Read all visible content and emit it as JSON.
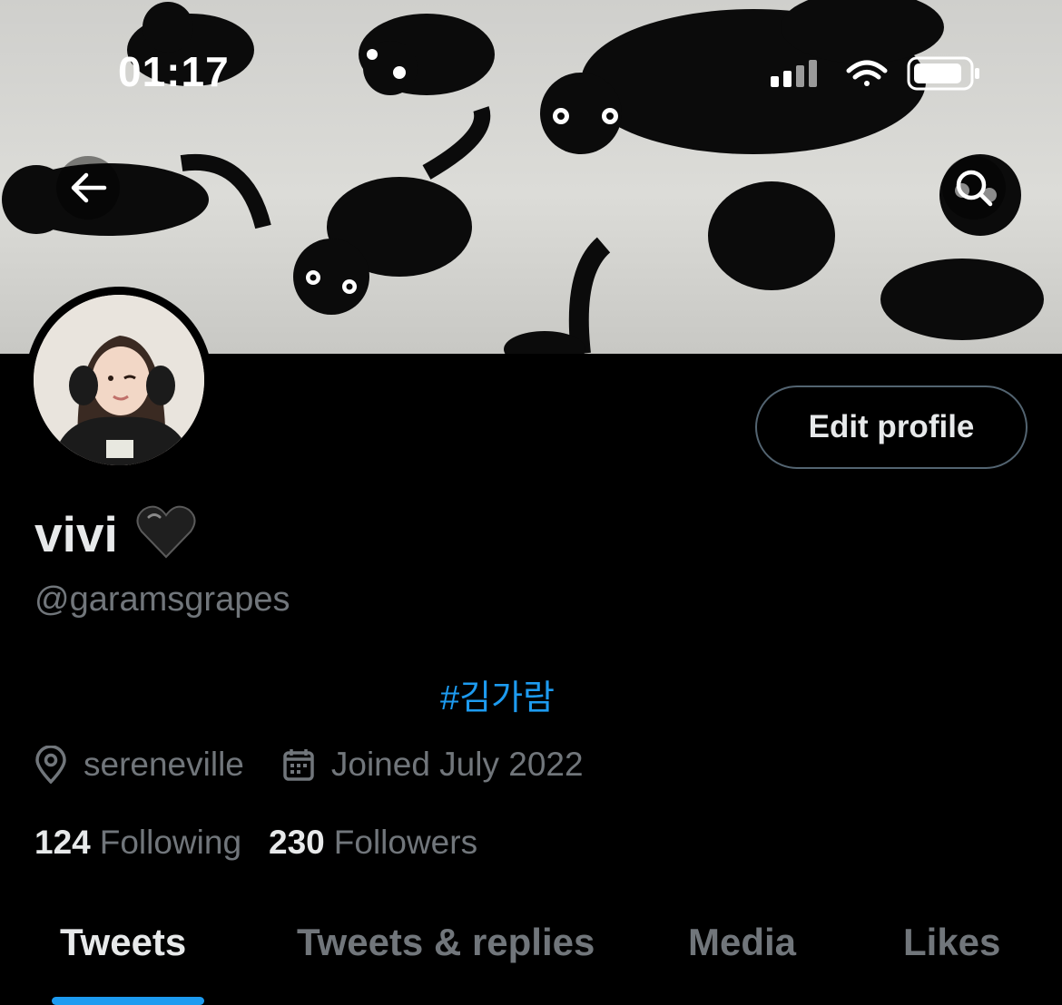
{
  "status_bar": {
    "time": "01:17"
  },
  "header": {
    "back_icon": "arrow-left-icon",
    "search_icon": "search-icon"
  },
  "profile": {
    "display_name": "vivi",
    "name_emoji": "black-heart",
    "handle": "@garamsgrapes",
    "bio": "#김가람",
    "location": "sereneville",
    "joined": "Joined July 2022",
    "following_count": "124",
    "following_label": "Following",
    "followers_count": "230",
    "followers_label": "Followers",
    "edit_button": "Edit profile"
  },
  "tabs": [
    {
      "label": "Tweets",
      "active": true
    },
    {
      "label": "Tweets & replies",
      "active": false
    },
    {
      "label": "Media",
      "active": false
    },
    {
      "label": "Likes",
      "active": false
    }
  ],
  "colors": {
    "background": "#000000",
    "accent": "#1d9bf0",
    "secondary_text": "#71767b",
    "primary_text": "#e7e9ea"
  }
}
